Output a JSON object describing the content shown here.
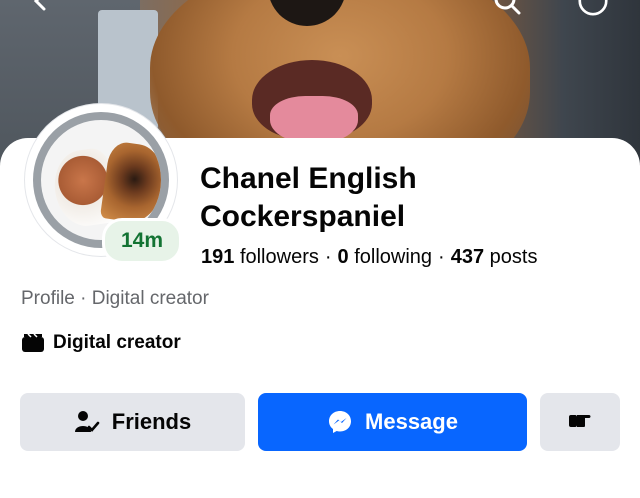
{
  "profile": {
    "name": "Chanel English Cockerspaniel",
    "story_badge": "14m",
    "stats": {
      "followers_count": "191",
      "followers_label": "followers",
      "following_count": "0",
      "following_label": "following",
      "posts_count": "437",
      "posts_label": "posts",
      "separator": "·"
    },
    "category_line": "Profile · Digital creator",
    "creator_label": "Digital creator"
  },
  "actions": {
    "friends_label": "Friends",
    "message_label": "Message"
  },
  "icons": {
    "back": "back-arrow-icon",
    "search": "search-icon",
    "more": "more-icon",
    "creator": "clapperboard-icon",
    "friends": "friend-check-icon",
    "messenger": "messenger-icon",
    "more_actions": "pointing-hand-icon"
  },
  "colors": {
    "primary": "#0866ff",
    "secondary_button": "#e4e6eb",
    "story_badge_bg": "#e7f3e8",
    "story_badge_text": "#137333",
    "muted_text": "#65676b"
  }
}
